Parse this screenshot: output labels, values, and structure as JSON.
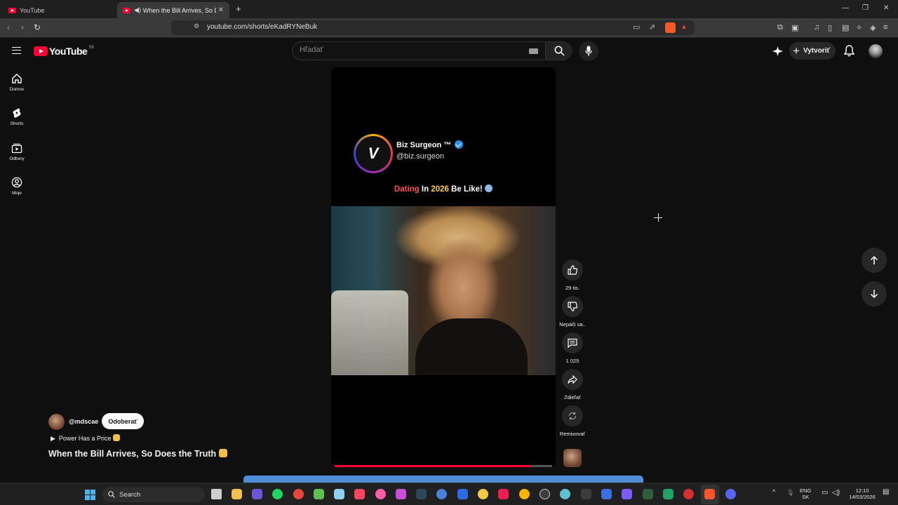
{
  "browser": {
    "tabs": [
      {
        "title": "YouTube"
      },
      {
        "title": "When the Bill Arrives, So Doe"
      }
    ],
    "url": "youtube.com/shorts/eKadRYNeBuk"
  },
  "masthead": {
    "logo_text": "YouTube",
    "region": "SK",
    "search_placeholder": "Hľadať",
    "create_label": "Vytvoriť"
  },
  "guide": {
    "items": [
      {
        "label": "Domov",
        "icon": "home-icon"
      },
      {
        "label": "Shorts",
        "icon": "shorts-icon"
      },
      {
        "label": "Odbery",
        "icon": "subscriptions-icon"
      },
      {
        "label": "Moje",
        "icon": "you-icon"
      }
    ]
  },
  "short": {
    "overlay_channel_name": "Biz Surgeon ™",
    "overlay_channel_handle": "@biz.surgeon",
    "overlay_caption": {
      "part1": "Dating",
      "part2": " In ",
      "part3": "2026",
      "part4": " Be Like! "
    },
    "owner_handle": "@mdscae",
    "subscribe_label": "Odoberať",
    "playlist_label": "Power Has a Price",
    "title": "When the Bill Arrives, So Does the Truth",
    "progress": 0.9
  },
  "actions": {
    "like_count": "29 tis.",
    "dislike_label": "Nepáči sa..",
    "comment_count": "1 025",
    "share_label": "Zdieľať",
    "remix_label": "Remixovať"
  },
  "taskbar": {
    "search_label": "Search",
    "lang_top": "ENG",
    "lang_bottom": "SK",
    "time": "12:10",
    "date": "14/03/2026"
  },
  "colors": {
    "accent_red": "#ff0033",
    "background": "#0f0f0f"
  }
}
